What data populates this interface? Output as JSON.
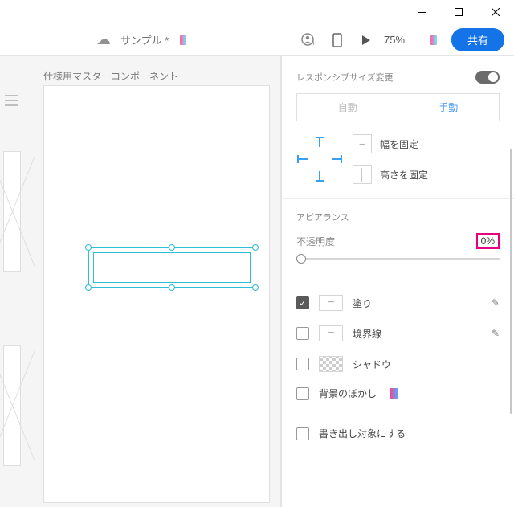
{
  "titlebar": {
    "min": "—",
    "max": "□",
    "close": "×"
  },
  "toolbar": {
    "doc_name": "サンプル *",
    "zoom": "75%",
    "share_label": "共有"
  },
  "canvas": {
    "component_title": "仕様用マスターコンポーネント"
  },
  "panel": {
    "responsive": {
      "heading": "レスポンシブサイズ変更",
      "auto": "自動",
      "manual": "手動",
      "fix_width": "幅を固定",
      "fix_height": "高さを固定"
    },
    "appearance": {
      "heading": "アピアランス",
      "opacity_label": "不透明度",
      "opacity_value": "0%"
    },
    "fill": {
      "label": "塗り"
    },
    "stroke": {
      "label": "境界線"
    },
    "shadow": {
      "label": "シャドウ"
    },
    "bgblur": {
      "label": "背景のぼかし"
    },
    "export": {
      "label": "書き出し対象にする"
    }
  }
}
